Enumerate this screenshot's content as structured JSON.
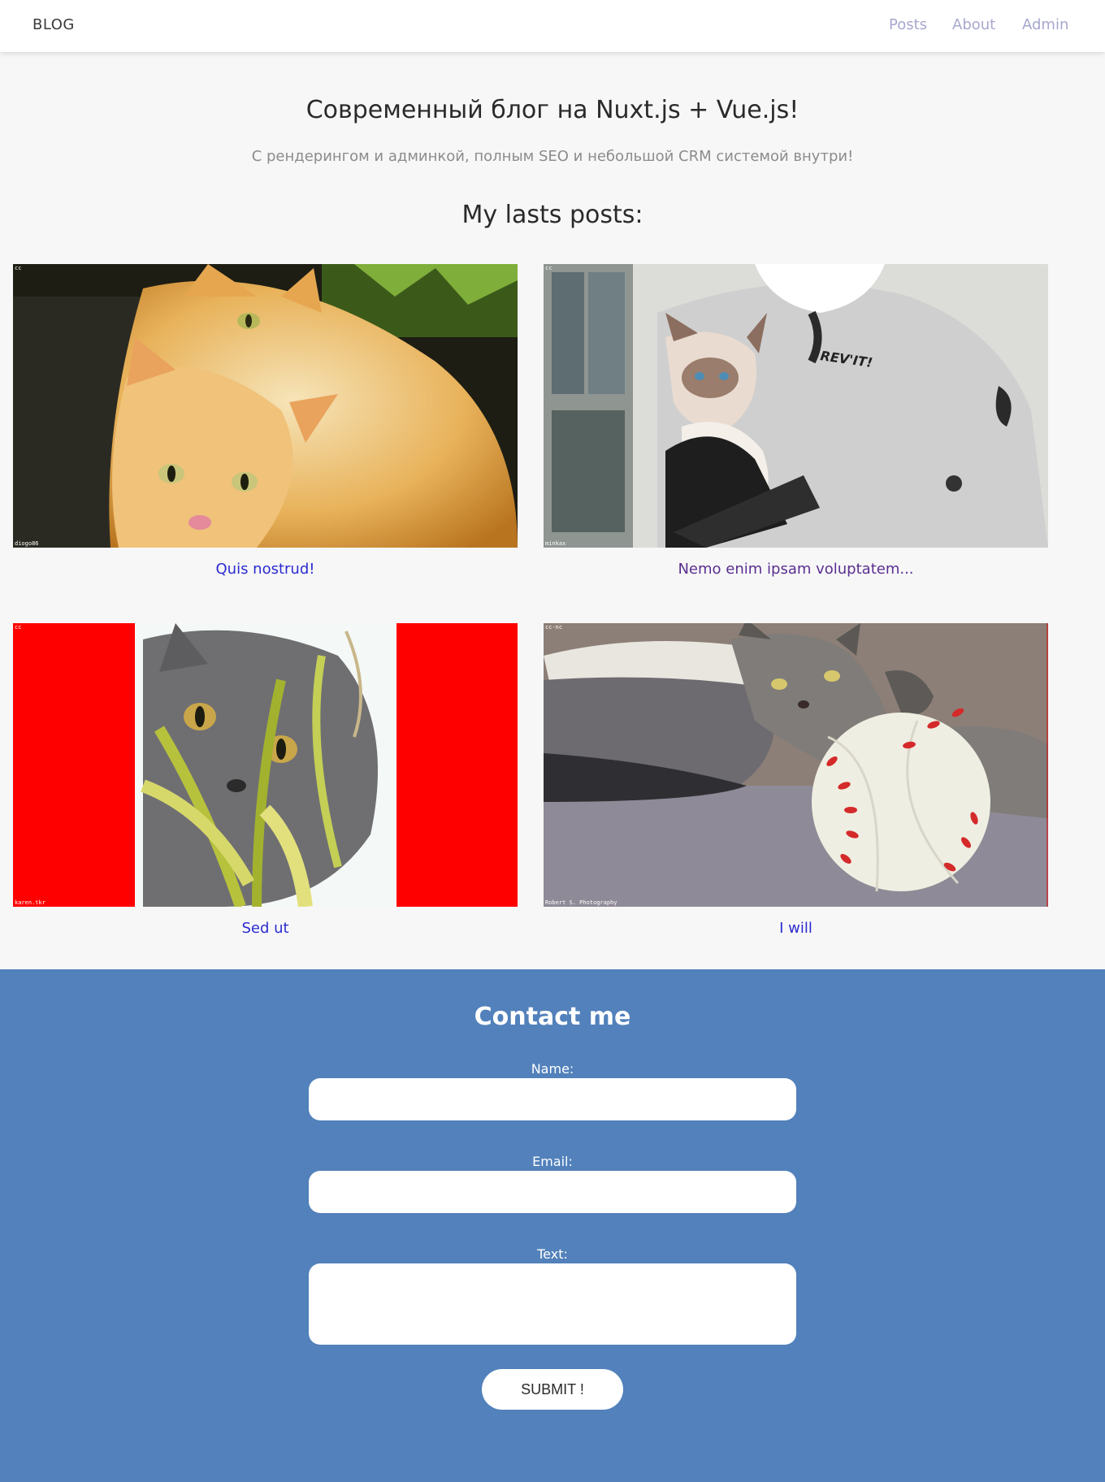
{
  "navbar": {
    "brand": "BLOG",
    "links": [
      "Posts",
      "About",
      "Admin"
    ]
  },
  "hero": {
    "title": "Современный блог на Nuxt.js + Vue.js!",
    "subtitle": "С рендерингом и админкой, полным SEO и небольшой CRM системой внутри!"
  },
  "posts_heading": "My lasts posts:",
  "posts": [
    {
      "title": "Quis nostrud!",
      "image": "two-ginger-kittens",
      "license": "cc",
      "credit": "diogo86"
    },
    {
      "title": "Nemo enim ipsam voluptatem...",
      "image": "kitten-held-by-rider",
      "license": "cc",
      "credit": "minkax"
    },
    {
      "title": "Sed ut",
      "image": "grey-cat-in-grass",
      "license": "cc",
      "credit": "karen.tkr"
    },
    {
      "title": "I will",
      "image": "tabby-cat-with-ball",
      "license": "cc-nc",
      "credit": "Robert S. Photography"
    }
  ],
  "contact": {
    "title": "Contact me",
    "name_label": "Name:",
    "email_label": "Email:",
    "text_label": "Text:",
    "name_value": "",
    "email_value": "",
    "text_value": "",
    "submit_label": "SUBMIT !"
  },
  "colors": {
    "nav_link": "#a7a7cf",
    "post_link": "#2b2bd0",
    "post_link_visited": "#5a2f8f",
    "contact_bg": "#5281bb",
    "page_bg": "#f7f7f8"
  }
}
